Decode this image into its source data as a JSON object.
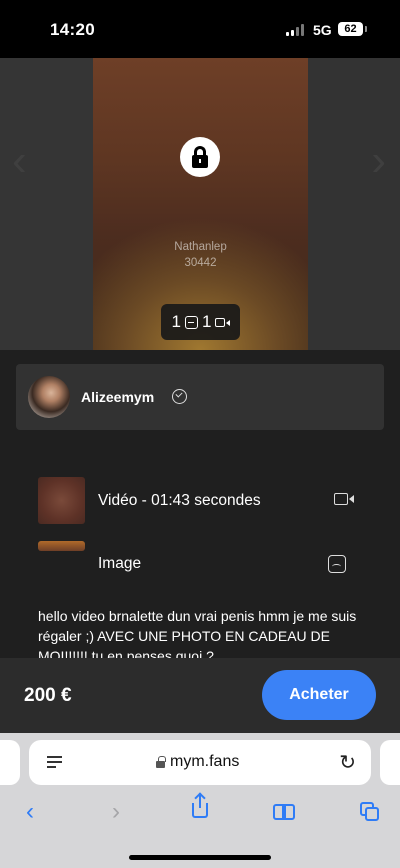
{
  "status_bar": {
    "time": "14:20",
    "network": "5G",
    "battery": "62"
  },
  "media": {
    "watermark_user": "Nathanlep",
    "watermark_id": "30442",
    "image_count": "1",
    "video_count": "1"
  },
  "creator": {
    "name": "Alizeemym",
    "verified": true
  },
  "items": [
    {
      "label": "Vidéo - 01:43 secondes",
      "type": "video"
    },
    {
      "label": "Image",
      "type": "image"
    }
  ],
  "description": "hello video brnalette dun vrai penis hmm je me suis régaler ;) AVEC UNE PHOTO EN CADEAU DE MOI!!!!!! tu en penses quoi ?",
  "purchase": {
    "price": "200 €",
    "button_label": "Acheter"
  },
  "browser": {
    "url": "mym.fans"
  },
  "colors": {
    "accent": "#3b82f6",
    "safari_blue": "#2f7cf6",
    "panel": "#1f1f1f"
  }
}
